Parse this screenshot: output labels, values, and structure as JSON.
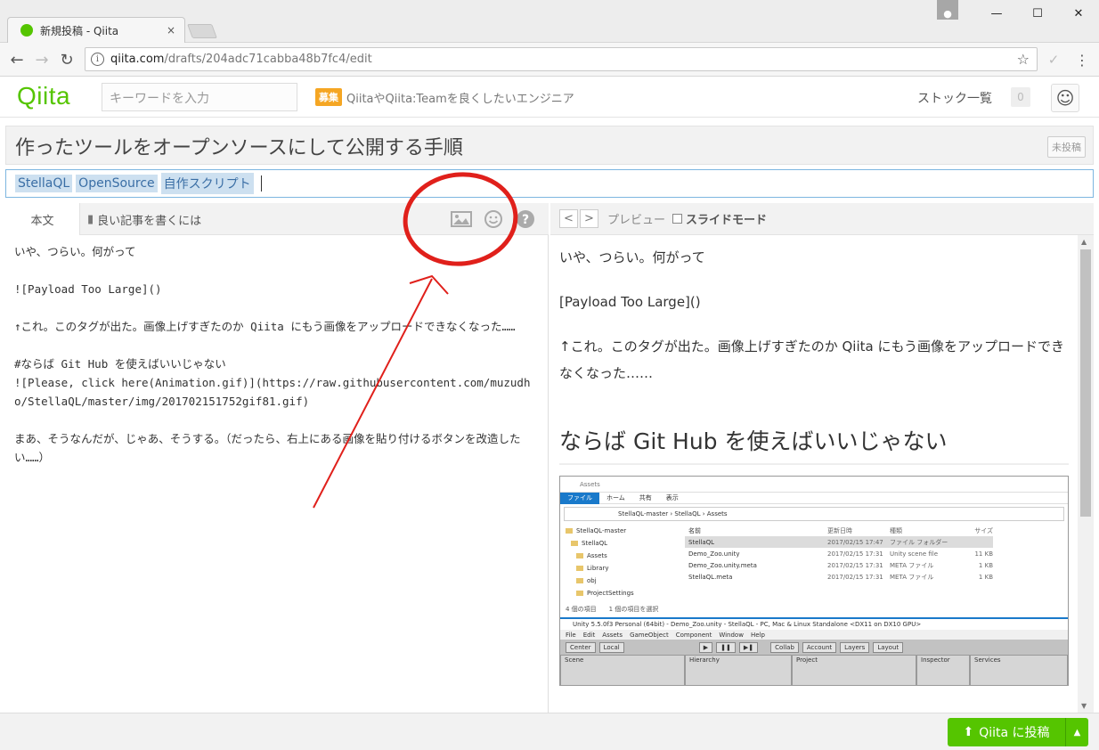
{
  "browser": {
    "tab_title": "新規投稿 - Qiita",
    "tab_close": "×",
    "url_host": "qiita.com",
    "url_path": "/drafts/204adc71cabba48b7fc4/edit",
    "info_glyph": "i",
    "star_glyph": "☆",
    "window_buttons": [
      "—",
      "☐",
      "✕"
    ]
  },
  "header": {
    "logo": "Qiita",
    "search_placeholder": "キーワードを入力",
    "recruit_badge": "募集",
    "recruit_text": "QiitaやQiita:Teamを良くしたいエンジニア",
    "stock_label": "ストック一覧",
    "stock_count": "0"
  },
  "editor": {
    "title": "作ったツールをオープンソースにして公開する手順",
    "status": "未投稿",
    "tags": [
      "StellaQL",
      "OpenSource",
      "自作スクリプト"
    ],
    "tabs": {
      "body": "本文",
      "guide": "良い記事を書くには"
    },
    "icons": [
      "image-upload-icon",
      "emoji-icon",
      "help-icon"
    ],
    "content": "いや、つらい。何がって\n\n![Payload Too Large]()\n\n↑これ。このタグが出た。画像上げすぎたのか Qiita にもう画像をアップロードできなくなった……\n\n#ならば Git Hub を使えばいいじゃない\n![Please, click here(Animation.gif)](https://raw.githubusercontent.com/muzudho/StellaQL/master/img/201702151752gif81.gif)\n\nまあ、そうなんだが、じゃあ、そうする。（だったら、右上にある画像を貼り付けるボタンを改造したい……）"
  },
  "preview": {
    "label": "プレビュー",
    "slide_mode": "スライドモード",
    "prev": "<",
    "next": ">",
    "p1": "いや、つらい。何がって",
    "p2": "[Payload Too Large]()",
    "p3": "↑これ。このタグが出た。画像上げすぎたのか Qiita にもう画像をアップロードできなくなった……",
    "h1": "ならば Git Hub を使えばいいじゃない",
    "shot": {
      "explorer_title": "Assets",
      "ribbon": [
        "ファイル",
        "ホーム",
        "共有",
        "表示"
      ],
      "address": "StellaQL-master › StellaQL › Assets",
      "tree": [
        "StellaQL-master",
        "StellaQL",
        "Assets",
        "Library",
        "obj",
        "ProjectSettings"
      ],
      "columns": [
        "名前",
        "更新日時",
        "種類",
        "サイズ"
      ],
      "files": [
        {
          "name": "StellaQL",
          "date": "2017/02/15 17:47",
          "type": "ファイル フォルダー",
          "size": ""
        },
        {
          "name": "Demo_Zoo.unity",
          "date": "2017/02/15 17:31",
          "type": "Unity scene file",
          "size": "11 KB"
        },
        {
          "name": "Demo_Zoo.unity.meta",
          "date": "2017/02/15 17:31",
          "type": "META ファイル",
          "size": "1 KB"
        },
        {
          "name": "StellaQL.meta",
          "date": "2017/02/15 17:31",
          "type": "META ファイル",
          "size": "1 KB"
        }
      ],
      "status": "4 個の項目　　1 個の項目を選択",
      "unity_title": "Unity 5.5.0f3 Personal (64bit) - Demo_Zoo.unity - StellaQL - PC, Mac & Linux Standalone <DX11 on DX10 GPU>",
      "unity_menu": [
        "File",
        "Edit",
        "Assets",
        "GameObject",
        "Component",
        "Window",
        "Help"
      ],
      "unity_tools": [
        "Center",
        "Local",
        "Collab",
        "Account",
        "Layers",
        "Layout"
      ],
      "unity_panels": [
        "Scene",
        "Hierarchy",
        "Project",
        "Inspector",
        "Services"
      ]
    }
  },
  "footer": {
    "post_label": "Qiita に投稿"
  },
  "colors": {
    "brand": "#55c500",
    "annotation": "#e0201b"
  }
}
